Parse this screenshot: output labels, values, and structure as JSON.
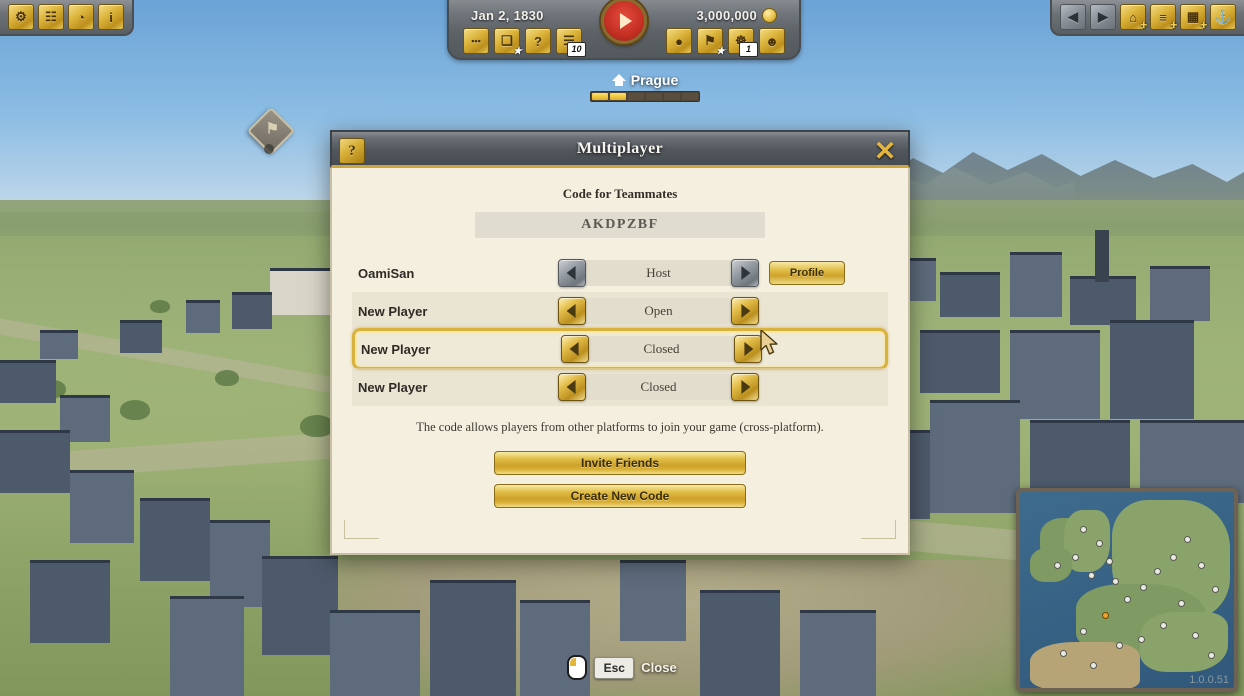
{
  "hud": {
    "left_icons": [
      {
        "name": "city-overview-icon",
        "glyph": "⚙"
      },
      {
        "name": "buildings-icon",
        "glyph": "☷"
      },
      {
        "name": "statistics-icon",
        "glyph": "◔"
      },
      {
        "name": "info-icon",
        "glyph": "i"
      }
    ],
    "date": "Jan 2, 1830",
    "money": "3,000,000",
    "play_button": "play-button",
    "center_icons_left": [
      {
        "name": "chat-icon",
        "glyph": "•••",
        "badge": "",
        "star": false
      },
      {
        "name": "screenshots-icon",
        "glyph": "❑",
        "badge": "",
        "star": true
      },
      {
        "name": "help-quests-icon",
        "glyph": "?",
        "badge": "",
        "star": false
      },
      {
        "name": "quests-icon",
        "glyph": "☰",
        "badge": "10",
        "star": false
      }
    ],
    "center_icons_right": [
      {
        "name": "hat-trade-icon",
        "glyph": "●",
        "badge": "",
        "star": false
      },
      {
        "name": "research-icon",
        "glyph": "⚑",
        "badge": "",
        "star": true
      },
      {
        "name": "expedition-icon",
        "glyph": "☸",
        "badge": "1",
        "star": false
      },
      {
        "name": "population-icon",
        "glyph": "☻",
        "badge": "",
        "star": false
      }
    ],
    "right_nav": [
      {
        "name": "back-arrow-icon",
        "glyph": "◀",
        "style": "steel"
      },
      {
        "name": "forward-arrow-icon",
        "glyph": "▶",
        "style": "steel"
      }
    ],
    "right_icons": [
      {
        "name": "build-residence-icon",
        "glyph": "⌂",
        "plus": "+"
      },
      {
        "name": "build-road-icon",
        "glyph": "≡",
        "plus": "+"
      },
      {
        "name": "build-production-icon",
        "glyph": "▦",
        "plus": "+"
      },
      {
        "name": "build-harbour-icon",
        "glyph": "⚓",
        "plus": ""
      }
    ]
  },
  "city_banner": {
    "name": "Prague",
    "progress_filled": 2,
    "progress_total": 6
  },
  "map_marker": {
    "glyph": "⚑"
  },
  "dialog": {
    "title": "Multiplayer",
    "help_icon": "?",
    "close_icon": "✕",
    "code_label": "Code for Teammates",
    "code_value": "AKDPZBF",
    "slots": [
      {
        "player": "OamiSan",
        "status": "Host",
        "left_arrow_style": "grey",
        "right_arrow_style": "grey",
        "profile_label": "Profile",
        "selected": false,
        "alt": false
      },
      {
        "player": "New Player",
        "status": "Open",
        "left_arrow_style": "gold",
        "right_arrow_style": "gold",
        "profile_label": "",
        "selected": false,
        "alt": true
      },
      {
        "player": "New Player",
        "status": "Closed",
        "left_arrow_style": "gold",
        "right_arrow_style": "gold",
        "profile_label": "",
        "selected": true,
        "alt": false
      },
      {
        "player": "New Player",
        "status": "Closed",
        "left_arrow_style": "gold",
        "right_arrow_style": "gold",
        "profile_label": "",
        "selected": false,
        "alt": true
      }
    ],
    "hint": "The code allows players from other platforms to join your game (cross-platform).",
    "invite_label": "Invite Friends",
    "create_code_label": "Create New Code"
  },
  "bottom_hint": {
    "mouse_icon": "mouse-icon",
    "key": "Esc",
    "action": "Close"
  },
  "minimap": {
    "version": "1.0.0.51"
  },
  "colors": {
    "gold": "#e0bc45",
    "gold_dark": "#8a6d18",
    "panel_cream": "#f4efdf",
    "title_grey": "#52575d",
    "highlight": "#d9b23e"
  }
}
